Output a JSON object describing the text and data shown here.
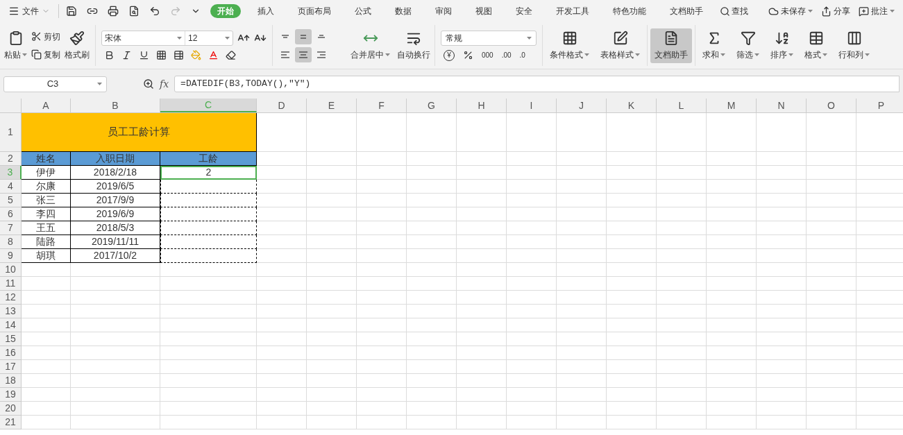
{
  "menu": {
    "file": "文件",
    "tabs": [
      {
        "label": "开始",
        "selected": true
      },
      {
        "label": "插入",
        "selected": false
      },
      {
        "label": "页面布局",
        "selected": false
      },
      {
        "label": "公式",
        "selected": false
      },
      {
        "label": "数据",
        "selected": false
      },
      {
        "label": "审阅",
        "selected": false
      },
      {
        "label": "视图",
        "selected": false
      },
      {
        "label": "安全",
        "selected": false
      },
      {
        "label": "开发工具",
        "selected": false
      },
      {
        "label": "特色功能",
        "selected": false
      },
      {
        "label": "文档助手",
        "selected": false
      }
    ],
    "search": "查找",
    "right": [
      {
        "label": "未保存"
      },
      {
        "label": "分享"
      },
      {
        "label": "批注"
      }
    ]
  },
  "ribbon": {
    "paste": "粘贴",
    "cut": "剪切",
    "copy": "复制",
    "format_painter": "格式刷",
    "font": "宋体",
    "size": "12",
    "vertical_align": [
      {
        "selected": false
      },
      {
        "selected": true
      },
      {
        "selected": false
      }
    ],
    "horizontal_align": [
      {
        "selected": false
      },
      {
        "selected": true
      },
      {
        "selected": false
      }
    ],
    "currency": "¥",
    "number_buttons": [
      {
        "label": "000"
      },
      {
        "label": ".00"
      },
      {
        "label": ".0"
      }
    ],
    "merge": "合并居中",
    "wrap": "自动换行",
    "number_format": "常规",
    "big_buttons": [
      {
        "label": "条件格式",
        "dropdown": true,
        "active": false
      },
      {
        "label": "表格样式",
        "dropdown": true,
        "active": false
      },
      {
        "label": "文档助手",
        "dropdown": false,
        "active": true
      },
      {
        "label": "求和",
        "dropdown": true,
        "active": false
      },
      {
        "label": "筛选",
        "dropdown": true,
        "active": false
      },
      {
        "label": "排序",
        "dropdown": true,
        "active": false
      },
      {
        "label": "格式",
        "dropdown": true,
        "active": false
      },
      {
        "label": "行和列",
        "dropdown": true,
        "active": false
      }
    ]
  },
  "formula_bar": {
    "name_box": "C3",
    "fx": "fx",
    "formula": "=DATEDIF(B3,TODAY(),\"Y\")"
  },
  "sheet": {
    "columns": [
      {
        "label": "A",
        "selected": false
      },
      {
        "label": "B",
        "selected": false
      },
      {
        "label": "C",
        "selected": true
      },
      {
        "label": "D",
        "selected": false
      },
      {
        "label": "E",
        "selected": false
      },
      {
        "label": "F",
        "selected": false
      },
      {
        "label": "G",
        "selected": false
      },
      {
        "label": "H",
        "selected": false
      },
      {
        "label": "I",
        "selected": false
      },
      {
        "label": "J",
        "selected": false
      },
      {
        "label": "K",
        "selected": false
      },
      {
        "label": "L",
        "selected": false
      },
      {
        "label": "M",
        "selected": false
      },
      {
        "label": "N",
        "selected": false
      },
      {
        "label": "O",
        "selected": false
      },
      {
        "label": "P",
        "selected": false
      }
    ],
    "rows": [
      {
        "label": "1",
        "selected": false,
        "kind": "title",
        "cells": [
          {
            "text": "员工工龄计算",
            "colspan": 3
          }
        ]
      },
      {
        "label": "2",
        "selected": false,
        "kind": "header",
        "cells": [
          {
            "text": "姓名"
          },
          {
            "text": "入职日期"
          },
          {
            "text": "工龄"
          }
        ]
      },
      {
        "label": "3",
        "selected": true,
        "kind": "data",
        "cells": [
          {
            "text": "伊伊"
          },
          {
            "text": "2018/2/18"
          },
          {
            "text": "2",
            "active": true,
            "marquee": true
          }
        ]
      },
      {
        "label": "4",
        "selected": false,
        "kind": "data",
        "cells": [
          {
            "text": "尔康"
          },
          {
            "text": "2019/6/5"
          },
          {
            "marquee": true
          }
        ]
      },
      {
        "label": "5",
        "selected": false,
        "kind": "data",
        "cells": [
          {
            "text": "张三"
          },
          {
            "text": "2017/9/9"
          },
          {
            "marquee": true
          }
        ]
      },
      {
        "label": "6",
        "selected": false,
        "kind": "data",
        "cells": [
          {
            "text": "李四"
          },
          {
            "text": "2019/6/9"
          },
          {
            "marquee": true
          }
        ]
      },
      {
        "label": "7",
        "selected": false,
        "kind": "data",
        "cells": [
          {
            "text": "王五"
          },
          {
            "text": "2018/5/3"
          },
          {
            "marquee": true
          }
        ]
      },
      {
        "label": "8",
        "selected": false,
        "kind": "data",
        "cells": [
          {
            "text": "陆路"
          },
          {
            "text": "2019/11/11"
          },
          {
            "marquee": true
          }
        ]
      },
      {
        "label": "9",
        "selected": false,
        "kind": "data",
        "cells": [
          {
            "text": "胡琪"
          },
          {
            "text": "2017/10/2"
          },
          {
            "marquee": true
          }
        ]
      },
      {
        "label": "10",
        "selected": false,
        "kind": "empty",
        "cells": []
      },
      {
        "label": "11",
        "selected": false,
        "kind": "empty",
        "cells": []
      },
      {
        "label": "12",
        "selected": false,
        "kind": "empty",
        "cells": []
      },
      {
        "label": "13",
        "selected": false,
        "kind": "empty",
        "cells": []
      },
      {
        "label": "14",
        "selected": false,
        "kind": "empty",
        "cells": []
      },
      {
        "label": "15",
        "selected": false,
        "kind": "empty",
        "cells": []
      },
      {
        "label": "16",
        "selected": false,
        "kind": "empty",
        "cells": []
      },
      {
        "label": "17",
        "selected": false,
        "kind": "empty",
        "cells": []
      },
      {
        "label": "18",
        "selected": false,
        "kind": "empty",
        "cells": []
      },
      {
        "label": "19",
        "selected": false,
        "kind": "empty",
        "cells": []
      },
      {
        "label": "20",
        "selected": false,
        "kind": "empty",
        "cells": []
      },
      {
        "label": "21",
        "selected": false,
        "kind": "empty",
        "cells": []
      }
    ]
  }
}
